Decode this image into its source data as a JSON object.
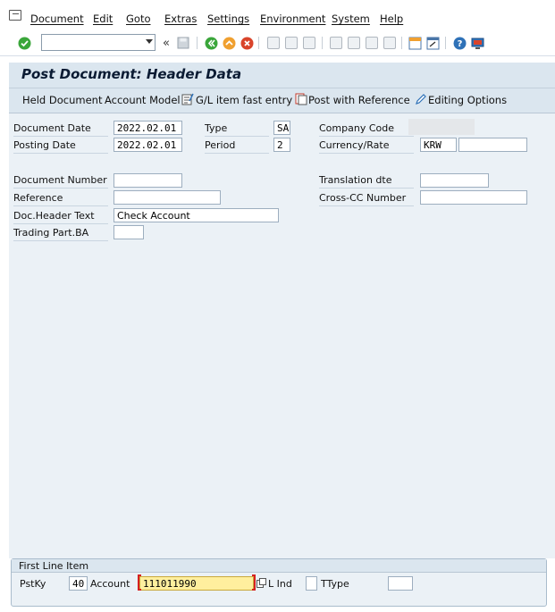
{
  "menu": {
    "items": [
      "Document",
      "Edit",
      "Goto",
      "Extras",
      "Settings",
      "Environment",
      "System",
      "Help"
    ]
  },
  "toolbar": {
    "command_value": "",
    "icons": [
      "enter-icon",
      "back-icon",
      "save-icon",
      "back-green-icon",
      "exit-icon",
      "cancel-icon",
      "print-icon",
      "find-icon",
      "find-next-icon",
      "first-page-icon",
      "prev-page-icon",
      "next-page-icon",
      "last-page-icon",
      "create-session-icon",
      "shortcut-icon",
      "help-icon",
      "customize-icon"
    ]
  },
  "screen": {
    "title": "Post Document: Header Data"
  },
  "app_toolbar": {
    "held_document": "Held Document",
    "account_model": "Account Model",
    "gl_fast_entry": "G/L item fast entry",
    "post_with_reference": "Post with Reference",
    "editing_options": "Editing Options"
  },
  "header": {
    "document_date_label": "Document Date",
    "document_date": "2022.02.01",
    "type_label": "Type",
    "type": "SA",
    "company_code_label": "Company Code",
    "company_code": "",
    "posting_date_label": "Posting Date",
    "posting_date": "2022.02.01",
    "period_label": "Period",
    "period": "2",
    "currency_rate_label": "Currency/Rate",
    "currency": "KRW",
    "rate": "",
    "document_number_label": "Document Number",
    "document_number": "",
    "translation_date_label": "Translation dte",
    "translation_date": "",
    "reference_label": "Reference",
    "reference": "",
    "cross_cc_label": "Cross-CC Number",
    "cross_cc": "",
    "doc_header_text_label": "Doc.Header Text",
    "doc_header_text": "Check Account",
    "trading_part_label": "Trading Part.BA",
    "trading_part": ""
  },
  "first_line_item": {
    "title": "First Line Item",
    "pstky_label": "PstKy",
    "pstky": "40",
    "account_label": "Account",
    "account": "111011990",
    "lind_label": "L Ind",
    "lind": "",
    "ttype_label": "TType",
    "ttype": ""
  },
  "colors": {
    "title_bg": "#dbe6ef",
    "content_bg": "#ebf1f6",
    "focused_field_bg": "#ffef9e",
    "focus_bracket": "#d62020"
  }
}
